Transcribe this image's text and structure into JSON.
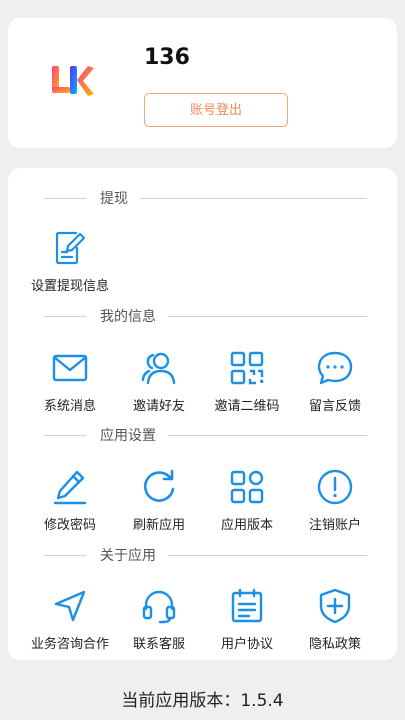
{
  "profile": {
    "username": "136",
    "logout_label": "账号登出"
  },
  "sections": [
    {
      "title": "提现",
      "items": [
        {
          "label": "设置提现信息",
          "icon": "edit-document-icon"
        }
      ]
    },
    {
      "title": "我的信息",
      "items": [
        {
          "label": "系统消息",
          "icon": "mail-icon"
        },
        {
          "label": "邀请好友",
          "icon": "users-icon"
        },
        {
          "label": "邀请二维码",
          "icon": "qrcode-icon"
        },
        {
          "label": "留言反馈",
          "icon": "chat-bubble-icon"
        }
      ]
    },
    {
      "title": "应用设置",
      "items": [
        {
          "label": "修改密码",
          "icon": "pencil-icon"
        },
        {
          "label": "刷新应用",
          "icon": "refresh-icon"
        },
        {
          "label": "应用版本",
          "icon": "apps-grid-icon"
        },
        {
          "label": "注销账户",
          "icon": "alert-circle-icon"
        }
      ]
    },
    {
      "title": "关于应用",
      "items": [
        {
          "label": "业务咨询合作",
          "icon": "navigation-icon"
        },
        {
          "label": "联系客服",
          "icon": "headset-icon"
        },
        {
          "label": "用户协议",
          "icon": "calendar-document-icon"
        },
        {
          "label": "隐私政策",
          "icon": "shield-plus-icon"
        }
      ]
    }
  ],
  "footer": {
    "version_text": "当前应用版本：1.5.4"
  },
  "colors": {
    "accent": "#1c8fe6",
    "logout": "#ee8b56",
    "background": "#efefef"
  }
}
